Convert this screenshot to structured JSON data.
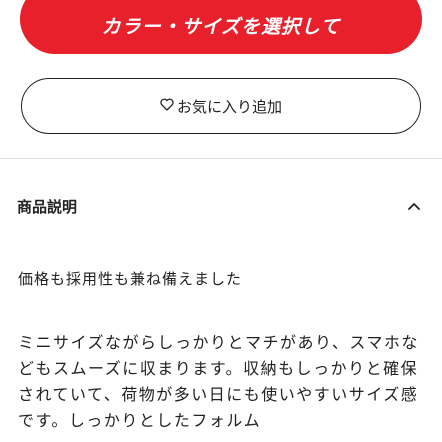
{
  "cart": {
    "button_label": "カラー・サイズを選択して"
  },
  "favorite": {
    "icon": "heart-outline-icon",
    "button_label": "お気に入り追加"
  },
  "product_description": {
    "title": "商品説明",
    "toggle_icon": "chevron-up-icon",
    "lead": "価格も採用性も兼ね備えました",
    "body": "ミニサイズながらしっかりとマチがあり、スマホなどもスムーズに収まります。収納もしっかりと確保されていて、荷物が多い日にも使いやすいサイズ感です。しっかりとしたフォルム"
  },
  "colors": {
    "accent": "#e8202b",
    "text": "#222222",
    "divider": "#dddddd"
  }
}
